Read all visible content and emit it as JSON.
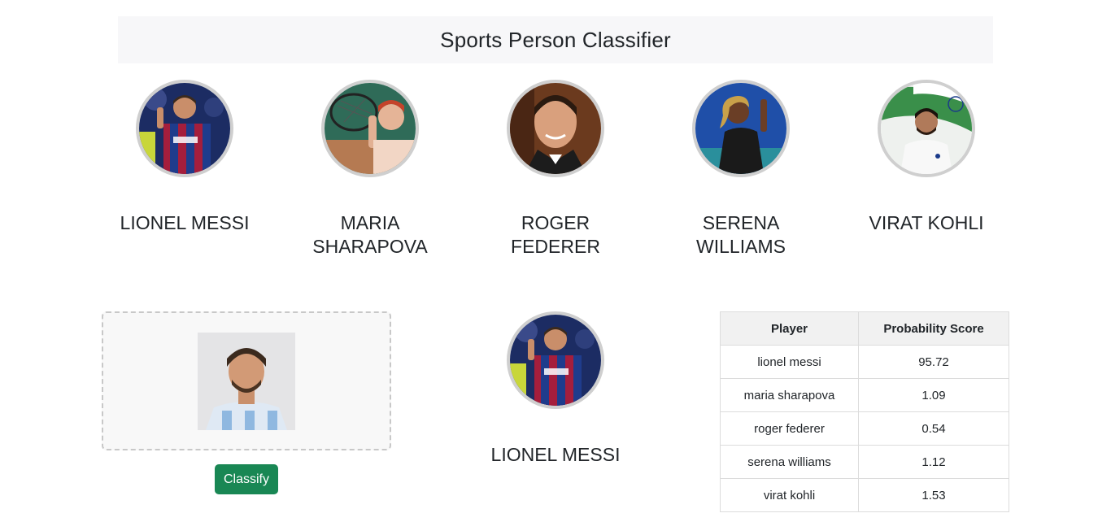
{
  "header": {
    "title": "Sports Person Classifier"
  },
  "players": [
    {
      "name": "Lionel Messi",
      "icon": "messi-photo"
    },
    {
      "name": "Maria Sharapova",
      "icon": "sharapova-photo"
    },
    {
      "name": "Roger Federer",
      "icon": "federer-photo"
    },
    {
      "name": "Serena Williams",
      "icon": "serena-photo"
    },
    {
      "name": "Virat Kohli",
      "icon": "kohli-photo"
    }
  ],
  "upload": {
    "icon": "uploaded-messi-photo"
  },
  "classify": {
    "label": "Classify",
    "color": "#198754"
  },
  "result": {
    "name": "Lionel Messi",
    "icon": "messi-photo"
  },
  "table": {
    "headers": [
      "Player",
      "Probability Score"
    ],
    "rows": [
      {
        "player": "lionel messi",
        "score": "95.72"
      },
      {
        "player": "maria sharapova",
        "score": "1.09"
      },
      {
        "player": "roger federer",
        "score": "0.54"
      },
      {
        "player": "serena williams",
        "score": "1.12"
      },
      {
        "player": "virat kohli",
        "score": "1.53"
      }
    ]
  }
}
